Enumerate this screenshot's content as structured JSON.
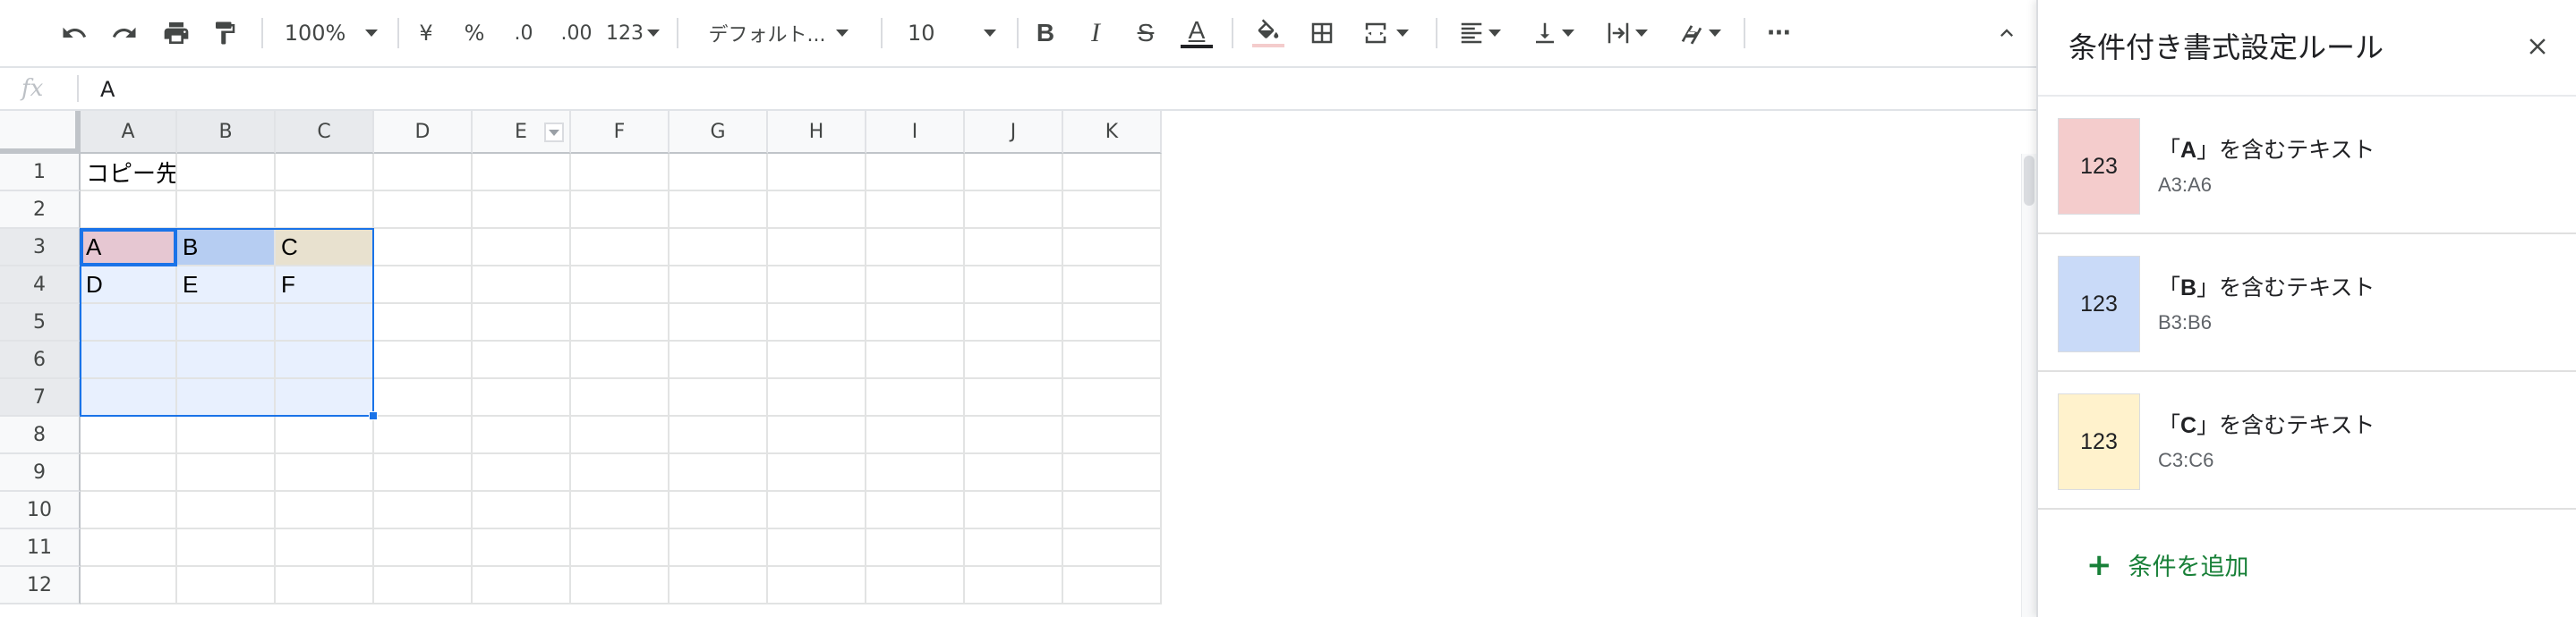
{
  "toolbar": {
    "zoom": "100%",
    "currency": "¥",
    "percent": "%",
    "decimal_decrease": ".0",
    "decimal_increase": ".00",
    "more_formats": "123",
    "font": "デフォルト...",
    "font_size": "10",
    "bold": "B",
    "italic": "I",
    "strikethrough": "S",
    "text_color": "A",
    "more": "···"
  },
  "formula_bar": {
    "fx": "fx",
    "value": "A"
  },
  "grid": {
    "columns": [
      "A",
      "B",
      "C",
      "D",
      "E",
      "F",
      "G",
      "H",
      "I",
      "J",
      "K"
    ],
    "rows": [
      "1",
      "2",
      "3",
      "4",
      "5",
      "6",
      "7",
      "8",
      "9",
      "10",
      "11",
      "12"
    ],
    "cells": {
      "A1": "コピー先",
      "A3": "A",
      "B3": "B",
      "C3": "C",
      "A4": "D",
      "B4": "E",
      "C4": "F"
    },
    "colors": {
      "selection_fill": "#e8f0fe",
      "A3_fill": "#e6c7d2",
      "B3_fill": "#b6cdf2",
      "C3_fill": "#e8e1cf",
      "accent": "#1a73e8"
    }
  },
  "panel": {
    "title": "条件付き書式設定ルール",
    "rules": [
      {
        "preview": "123",
        "prefix": "「",
        "value": "A",
        "suffix": "」を含むテキスト",
        "range": "A3:A6",
        "color": "#f4cccc"
      },
      {
        "preview": "123",
        "prefix": "「",
        "value": "B",
        "suffix": "」を含むテキスト",
        "range": "B3:B6",
        "color": "#c9daf8"
      },
      {
        "preview": "123",
        "prefix": "「",
        "value": "C",
        "suffix": "」を含むテキスト",
        "range": "C3:C6",
        "color": "#fff2cc"
      }
    ],
    "add_rule_icon": "+",
    "add_rule_label": "条件を追加",
    "add_rule_color": "#188038"
  }
}
